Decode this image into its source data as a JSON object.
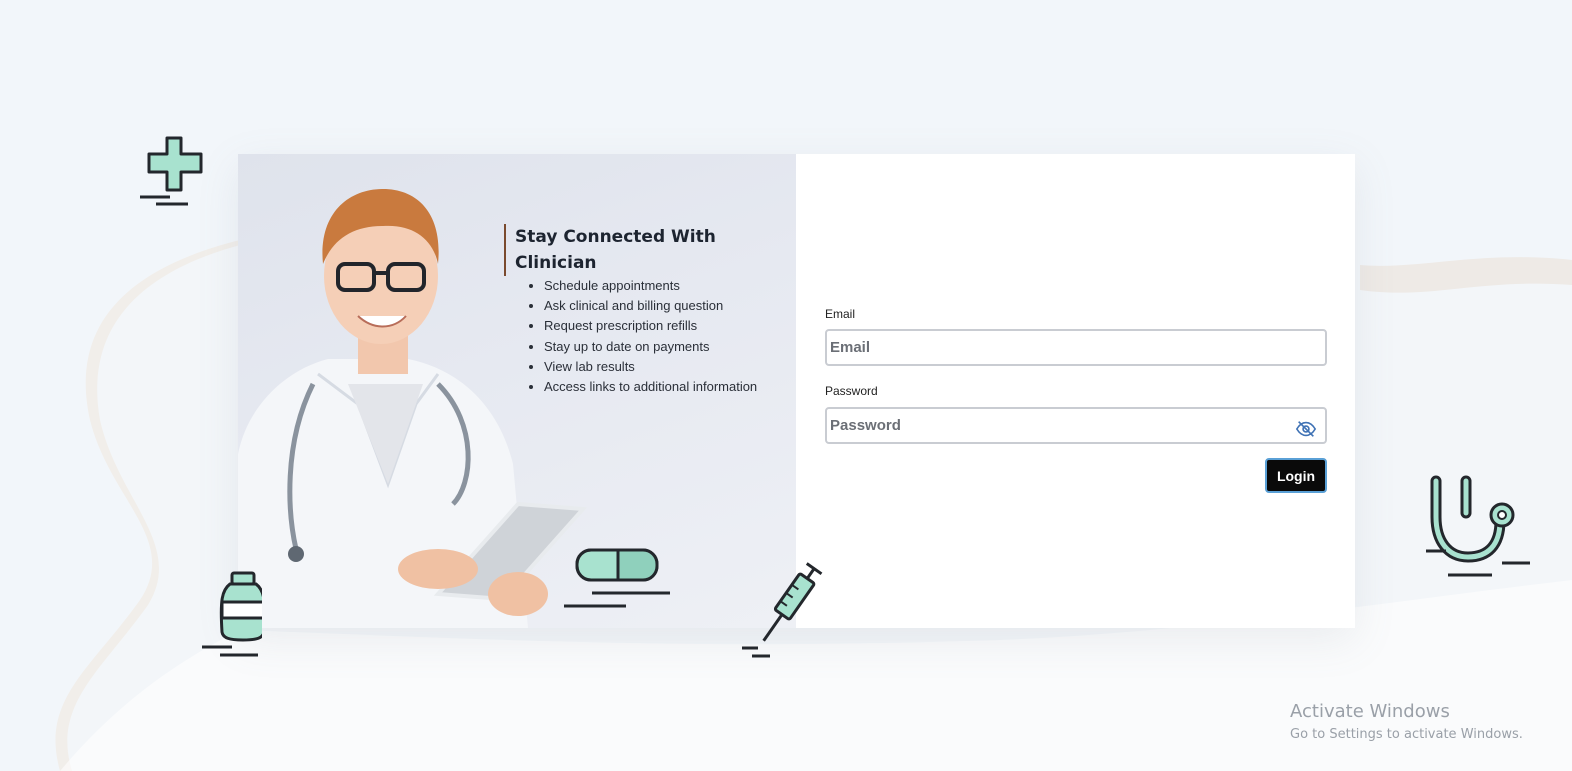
{
  "hero": {
    "title": "Stay Connected With Clinician",
    "features": [
      "Schedule appointments",
      "Ask clinical and billing question",
      "Request prescription refills",
      "Stay up to date on payments",
      "View lab results",
      "Access links to additional information"
    ]
  },
  "login_form": {
    "email_label": "Email",
    "email_placeholder": "Email",
    "password_label": "Password",
    "password_placeholder": "Password",
    "password_toggle_icon": "eye-slash-icon",
    "login_button": "Login"
  },
  "decorations": {
    "icons": [
      "medical-cross-icon",
      "medicine-bottle-icon",
      "pill-capsule-icon",
      "syringe-icon",
      "stethoscope-icon"
    ],
    "accent_color": "#a8e2cf"
  },
  "windows_watermark": {
    "title": "Activate Windows",
    "subtitle": "Go to Settings to activate Windows."
  }
}
